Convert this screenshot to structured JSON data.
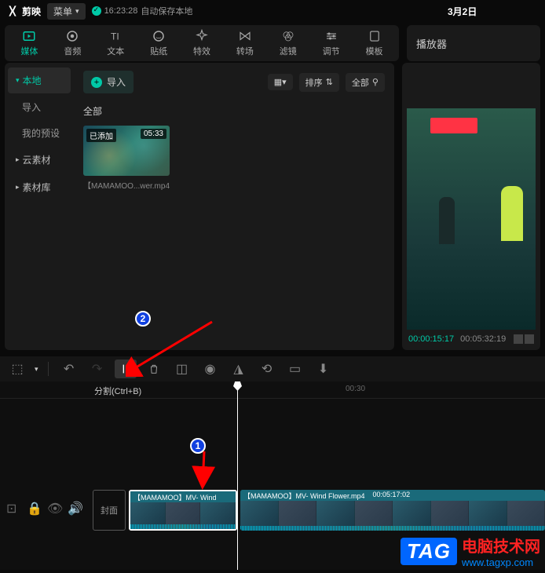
{
  "app_name": "剪映",
  "menu_label": "菜单",
  "autosave": {
    "time": "16:23:28",
    "text": "自动保存本地"
  },
  "date": "3月2日",
  "tabs": [
    "媒体",
    "音频",
    "文本",
    "贴纸",
    "特效",
    "转场",
    "滤镜",
    "调节",
    "模板"
  ],
  "player_label": "播放器",
  "sidebar": {
    "local": "本地",
    "import": "导入",
    "presets": "我的预设",
    "cloud": "云素材",
    "library": "素材库"
  },
  "media": {
    "import_btn": "导入",
    "sort": "排序",
    "all": "全部",
    "section": "全部",
    "thumb": {
      "added": "已添加",
      "duration": "05:33",
      "name": "【MAMAMOO...wer.mp4"
    }
  },
  "player": {
    "current": "00:00:15:17",
    "total": "00:05:32:19"
  },
  "timeline": {
    "split_hint": "分割(Ctrl+B)",
    "tick_30": "00:30",
    "cover": "封面",
    "clip1_label": "【MAMAMOO】MV- Wind",
    "clip2_label": "【MAMAMOO】MV- Wind Flower.mp4",
    "clip2_dur": "00:05:17:02"
  },
  "anno": {
    "n1": "1",
    "n2": "2"
  },
  "watermark": {
    "tag": "TAG",
    "line1": "电脑技术网",
    "line2": "www.tagxp.com"
  }
}
